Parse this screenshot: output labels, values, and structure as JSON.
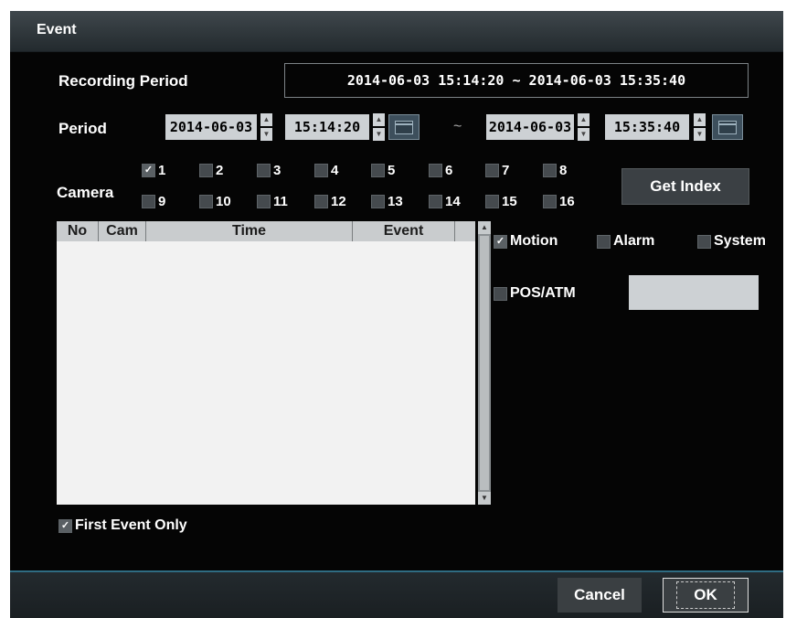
{
  "dialog": {
    "title": "Event"
  },
  "recording": {
    "label": "Recording Period",
    "value": "2014-06-03  15:14:20  ~  2014-06-03  15:35:40"
  },
  "period": {
    "label": "Period",
    "start_date": "2014-06-03",
    "start_time": "15:14:20",
    "separator": "~",
    "end_date": "2014-06-03",
    "end_time": "15:35:40"
  },
  "camera": {
    "label": "Camera",
    "items": [
      {
        "label": "1",
        "checked": true
      },
      {
        "label": "2",
        "checked": false
      },
      {
        "label": "3",
        "checked": false
      },
      {
        "label": "4",
        "checked": false
      },
      {
        "label": "5",
        "checked": false
      },
      {
        "label": "6",
        "checked": false
      },
      {
        "label": "7",
        "checked": false
      },
      {
        "label": "8",
        "checked": false
      },
      {
        "label": "9",
        "checked": false
      },
      {
        "label": "10",
        "checked": false
      },
      {
        "label": "11",
        "checked": false
      },
      {
        "label": "12",
        "checked": false
      },
      {
        "label": "13",
        "checked": false
      },
      {
        "label": "14",
        "checked": false
      },
      {
        "label": "15",
        "checked": false
      },
      {
        "label": "16",
        "checked": false
      }
    ],
    "get_index_label": "Get Index"
  },
  "event_list": {
    "columns": [
      "No",
      "Cam",
      "Time",
      "Event"
    ],
    "rows": []
  },
  "filters": {
    "motion": {
      "label": "Motion",
      "checked": true
    },
    "alarm": {
      "label": "Alarm",
      "checked": false
    },
    "system": {
      "label": "System",
      "checked": false
    },
    "pos_atm": {
      "label": "POS/ATM",
      "checked": false,
      "value": ""
    }
  },
  "first_event_only": {
    "label": "First Event Only",
    "checked": true
  },
  "footer": {
    "cancel_label": "Cancel",
    "ok_label": "OK"
  },
  "colors": {
    "background": "#050505",
    "title_bar": "#2c3438",
    "accent_line": "#2f6c82",
    "field": "#cdd1d4"
  }
}
